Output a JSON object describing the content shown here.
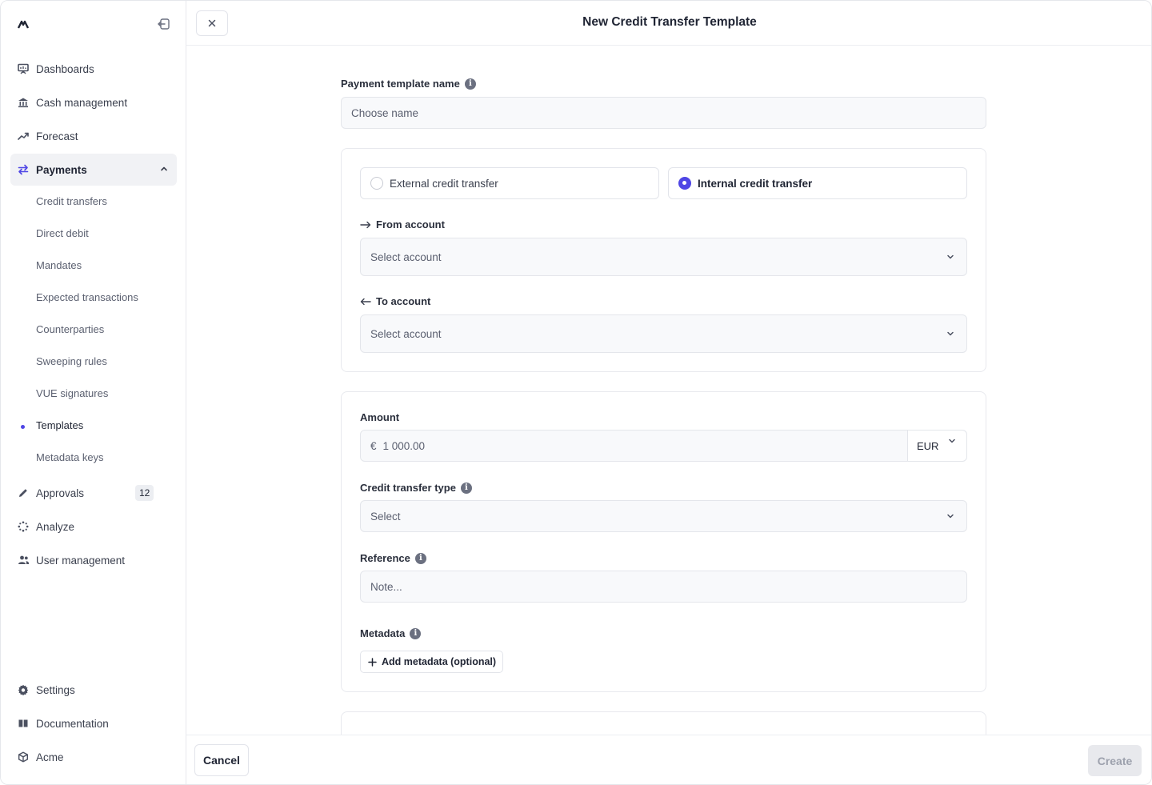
{
  "sidebar": {
    "nav": [
      {
        "label": "Dashboards",
        "icon": "presentation-chart-icon"
      },
      {
        "label": "Cash management",
        "icon": "bank-icon"
      },
      {
        "label": "Forecast",
        "icon": "trend-up-icon"
      },
      {
        "label": "Payments",
        "icon": "arrows-exchange-icon"
      }
    ],
    "payments_sub": [
      "Credit transfers",
      "Direct debit",
      "Mandates",
      "Expected transactions",
      "Counterparties",
      "Sweeping rules",
      "VUE signatures",
      "Templates",
      "Metadata keys"
    ],
    "approvals": {
      "label": "Approvals",
      "count": "12"
    },
    "analyze": "Analyze",
    "user_management": "User management",
    "settings": "Settings",
    "documentation": "Documentation",
    "org": "Acme"
  },
  "header": {
    "title": "New Credit Transfer Template"
  },
  "form": {
    "template_name": {
      "label": "Payment template name",
      "placeholder": "Choose name"
    },
    "transfer_options": {
      "external": "External credit transfer",
      "internal": "Internal credit transfer",
      "selected": "internal"
    },
    "from_account": {
      "label": "From account",
      "placeholder": "Select account"
    },
    "to_account": {
      "label": "To account",
      "placeholder": "Select account"
    },
    "amount": {
      "label": "Amount",
      "symbol": "€",
      "value": "1 000.00",
      "currency": "EUR"
    },
    "credit_transfer_type": {
      "label": "Credit transfer type",
      "placeholder": "Select"
    },
    "reference": {
      "label": "Reference",
      "placeholder": "Note..."
    },
    "metadata": {
      "label": "Metadata",
      "add_button": "Add metadata (optional)"
    }
  },
  "footer": {
    "cancel": "Cancel",
    "create": "Create"
  },
  "colors": {
    "accent": "#4f46e5",
    "disabled_bg": "#e8e9ed"
  }
}
